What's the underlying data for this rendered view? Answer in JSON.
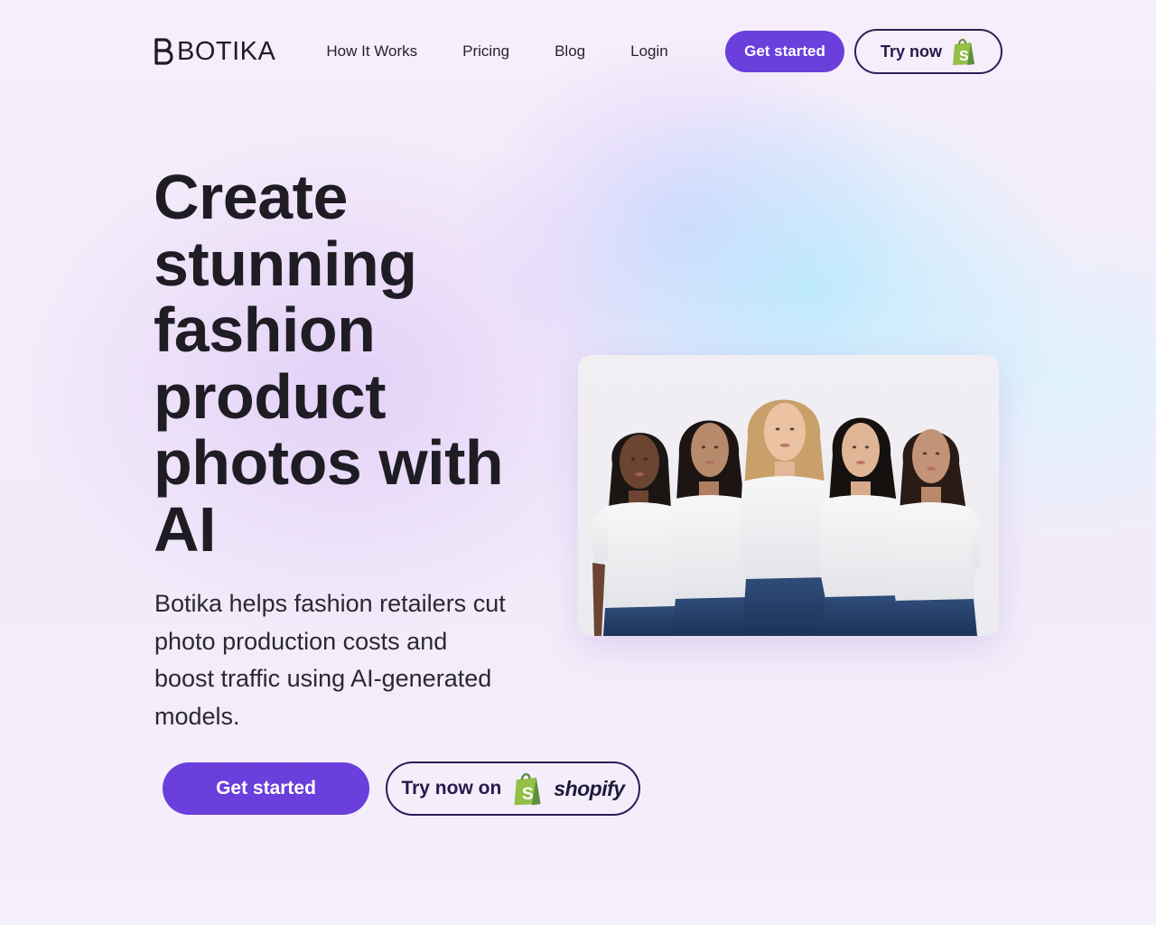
{
  "brand": {
    "name": "BOTIKA",
    "accent_color": "#6a3fdc",
    "outline_color": "#2a1f55",
    "shopify_green": "#95bf47"
  },
  "nav": {
    "links": [
      {
        "label": "How It Works"
      },
      {
        "label": "Pricing"
      },
      {
        "label": "Blog"
      },
      {
        "label": "Login"
      }
    ],
    "get_started_label": "Get started",
    "try_now_label": "Try now",
    "shopify_icon": "shopify-bag-icon"
  },
  "hero": {
    "title": "Create stunning fashion product photos with AI",
    "subtitle": "Botika helps fashion retailers cut photo production costs and boost traffic using AI-generated models.",
    "cta_primary": "Get started",
    "cta_secondary": "Try now on",
    "cta_secondary_brand": "shopify",
    "image": {
      "subject": "five models in white t-shirts and jeans",
      "model_count": 5
    }
  }
}
